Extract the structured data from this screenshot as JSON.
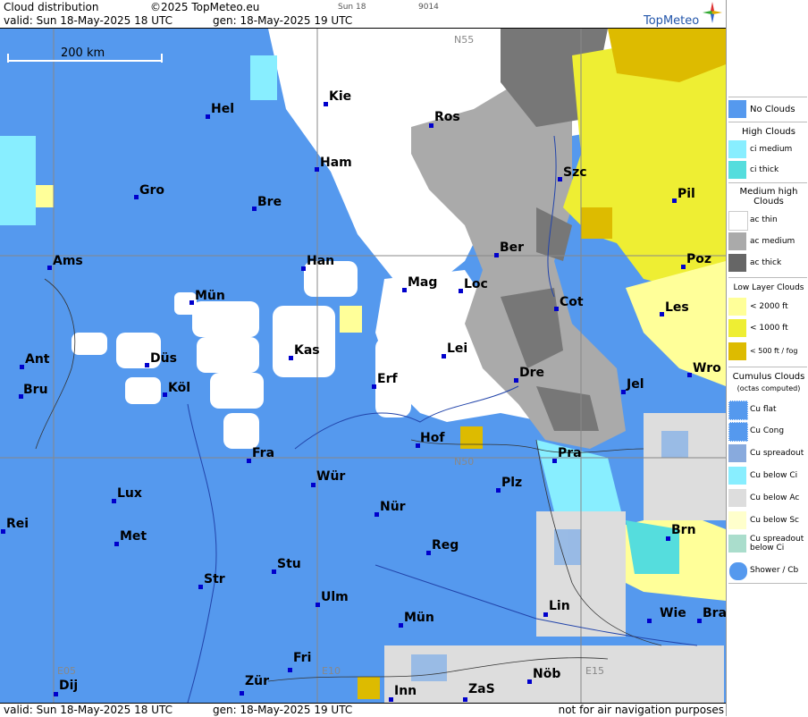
{
  "header": {
    "title": "Cloud distribution",
    "copyright": "©2025 TopMeteo.eu",
    "day_small": "Sun 18",
    "code_small": "9014",
    "valid": "valid:  Sun  18-May-2025  18 UTC",
    "gen": "gen: 18-May-2025 19 UTC",
    "brand": "TopMeteo"
  },
  "footer": {
    "valid": "valid:  Sun  18-May-2025  18 UTC",
    "gen": "gen: 18-May-2025 19 UTC",
    "disclaimer": "not for air navigation purposes"
  },
  "map": {
    "scale_label": "200 km",
    "grid_labels": [
      "N55",
      "N50",
      "E05",
      "E10",
      "E15"
    ],
    "cities": [
      "Kie",
      "Hel",
      "Ros",
      "Ham",
      "Gro",
      "Bre",
      "Szc",
      "Pil",
      "Ams",
      "Han",
      "Ber",
      "Mag",
      "Loc",
      "Poz",
      "Mün",
      "Cot",
      "Les",
      "Kas",
      "Lei",
      "Ant",
      "Düs",
      "Dre",
      "Wro",
      "Bru",
      "Köl",
      "Erf",
      "Jel",
      "Hof",
      "Fra",
      "Pra",
      "Wür",
      "Plz",
      "Lux",
      "Nür",
      "Rei",
      "Met",
      "Reg",
      "Brn",
      "Stu",
      "Str",
      "Ulm",
      "Lin",
      "Mün",
      "Wie",
      "Bra",
      "Fri",
      "Dij",
      "Zür",
      "Inn",
      "ZaS",
      "Nöb"
    ]
  },
  "legend": {
    "no_clouds": "No Clouds",
    "high_head": "High Clouds",
    "ci_medium": "ci medium",
    "ci_thick": "ci thick",
    "medium_head": "Medium high Clouds",
    "ac_thin": "ac thin",
    "ac_medium": "ac medium",
    "ac_thick": "ac thick",
    "low_head": "Low Layer Clouds",
    "low_2000": "< 2000 ft",
    "low_1000": "< 1000 ft",
    "low_500": "< 500 ft / fog",
    "cu_head": "Cumulus Clouds",
    "cu_sub": "(octas computed)",
    "cu_flat": "Cu flat",
    "cu_cong": "Cu Cong",
    "cu_spreadout": "Cu spreadout",
    "cu_below_ci": "Cu below Ci",
    "cu_below_ac": "Cu below Ac",
    "cu_below_sc": "Cu below Sc",
    "cu_spreadout_below_ci": "Cu spreadout below Ci",
    "shower_cb": "Shower / Cb",
    "colors": {
      "no_clouds": "#5599ee",
      "ci_medium": "#88eeff",
      "ci_thick": "#55dddd",
      "ac_thin": "#ffffff",
      "ac_medium": "#aaaaaa",
      "ac_thick": "#666666",
      "low_2000": "#ffff99",
      "low_1000": "#eeee33",
      "low_500": "#ddbb00"
    }
  }
}
